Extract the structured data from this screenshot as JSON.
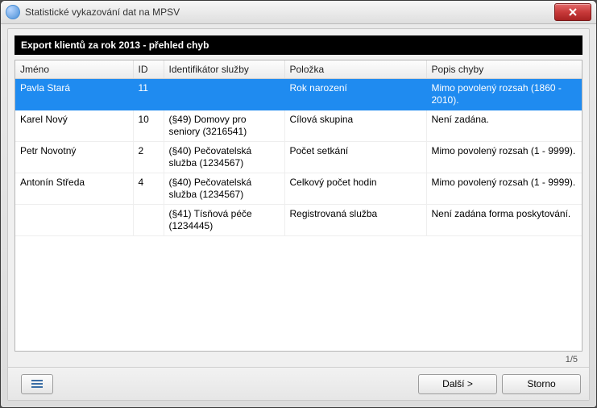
{
  "window": {
    "title": "Statistické vykazování dat na MPSV"
  },
  "banner": "Export klientů za rok 2013 - přehled chyb",
  "columns": {
    "name": "Jméno",
    "id": "ID",
    "service": "Identifikátor služby",
    "item": "Položka",
    "desc": "Popis chyby"
  },
  "rows": [
    {
      "name": "Pavla Stará",
      "id": "11",
      "service": "",
      "item": "Rok narození",
      "desc": "Mimo povolený rozsah (1860 - 2010).",
      "selected": true
    },
    {
      "name": "Karel Nový",
      "id": "10",
      "service": "(§49) Domovy pro seniory (3216541)",
      "item": "Cílová skupina",
      "desc": "Není zadána."
    },
    {
      "name": "Petr Novotný",
      "id": "2",
      "service": "(§40) Pečovatelská služba (1234567)",
      "item": "Počet setkání",
      "desc": "Mimo povolený rozsah (1 - 9999)."
    },
    {
      "name": "Antonín Středa",
      "id": "4",
      "service": "(§40) Pečovatelská služba (1234567)",
      "item": "Celkový počet hodin",
      "desc": "Mimo povolený rozsah (1 - 9999)."
    },
    {
      "name": "",
      "id": "",
      "service": "(§41) Tísňová péče (1234445)",
      "item": "Registrovaná služba",
      "desc": "Není zadána forma poskytování."
    }
  ],
  "pager": "1/5",
  "buttons": {
    "next": "Další >",
    "cancel": "Storno"
  }
}
